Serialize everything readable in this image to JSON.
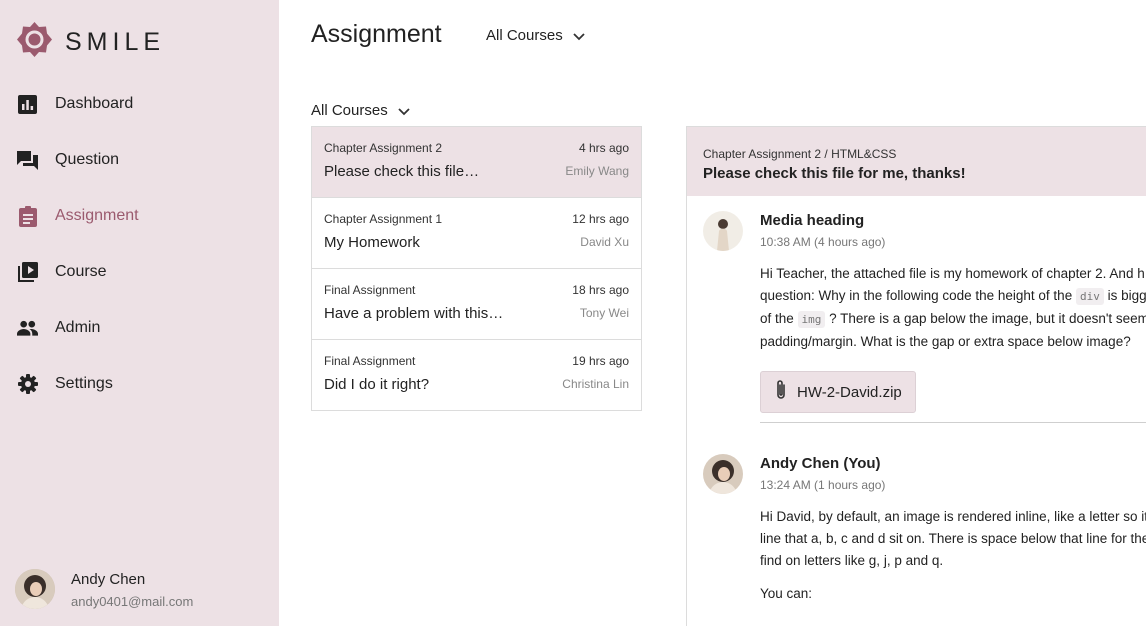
{
  "app": {
    "logo_text": "SMILE"
  },
  "sidebar": {
    "items": [
      {
        "label": "Dashboard",
        "icon": "dashboard-icon"
      },
      {
        "label": "Question",
        "icon": "forum-icon"
      },
      {
        "label": "Assignment",
        "icon": "assignment-icon",
        "active": true
      },
      {
        "label": "Course",
        "icon": "video-library-icon"
      },
      {
        "label": "Admin",
        "icon": "people-icon"
      },
      {
        "label": "Settings",
        "icon": "gear-icon"
      }
    ],
    "user": {
      "name": "Andy Chen",
      "email": "andy0401@mail.com"
    }
  },
  "header": {
    "title": "Assignment",
    "filter_label": "All Courses"
  },
  "list": {
    "filter_label": "All Courses",
    "items": [
      {
        "category": "Chapter Assignment 2",
        "time": "4 hrs ago",
        "title": "Please check this file…",
        "author": "Emily Wang",
        "selected": true
      },
      {
        "category": "Chapter Assignment 1",
        "time": "12 hrs ago",
        "title": "My Homework",
        "author": "David Xu"
      },
      {
        "category": "Final Assignment",
        "time": "18 hrs ago",
        "title": "Have a problem with this…",
        "author": "Tony Wei"
      },
      {
        "category": "Final Assignment",
        "time": "19 hrs ago",
        "title": "Did I do it right?",
        "author": "Christina Lin"
      }
    ]
  },
  "detail": {
    "breadcrumb": "Chapter Assignment 2 / HTML&CSS",
    "title": "Please check this file for me, thanks!",
    "messages": [
      {
        "name": "Media heading",
        "time": "10:38 AM (4 hours ago)",
        "line1": "Hi Teacher, the attached file is my homework of chapter 2. And h",
        "line2_pre": "question: Why in the following code the height of the ",
        "code1": "div",
        "line2_post": " is bigg",
        "line3_pre": "of the ",
        "code2": "img",
        "line3_post": " ? There is a gap below the image, but it doesn't seems",
        "line4": "padding/margin. What is the gap or extra space below image?",
        "attachment": "HW-2-David.zip"
      },
      {
        "name": "Andy Chen (You)",
        "time": "13:24 AM (1 hours ago)",
        "line1": "Hi David, by default, an image is rendered inline, like a letter so it",
        "line2": "line that a, b, c and d sit on. There is space below that line for the",
        "line3": "find on letters like g, j, p and q.",
        "line4": "You can:"
      }
    ]
  },
  "colors": {
    "sidebar_bg": "#ede1e5",
    "accent": "#9b5a6e",
    "logo": "#9b5a6e"
  }
}
